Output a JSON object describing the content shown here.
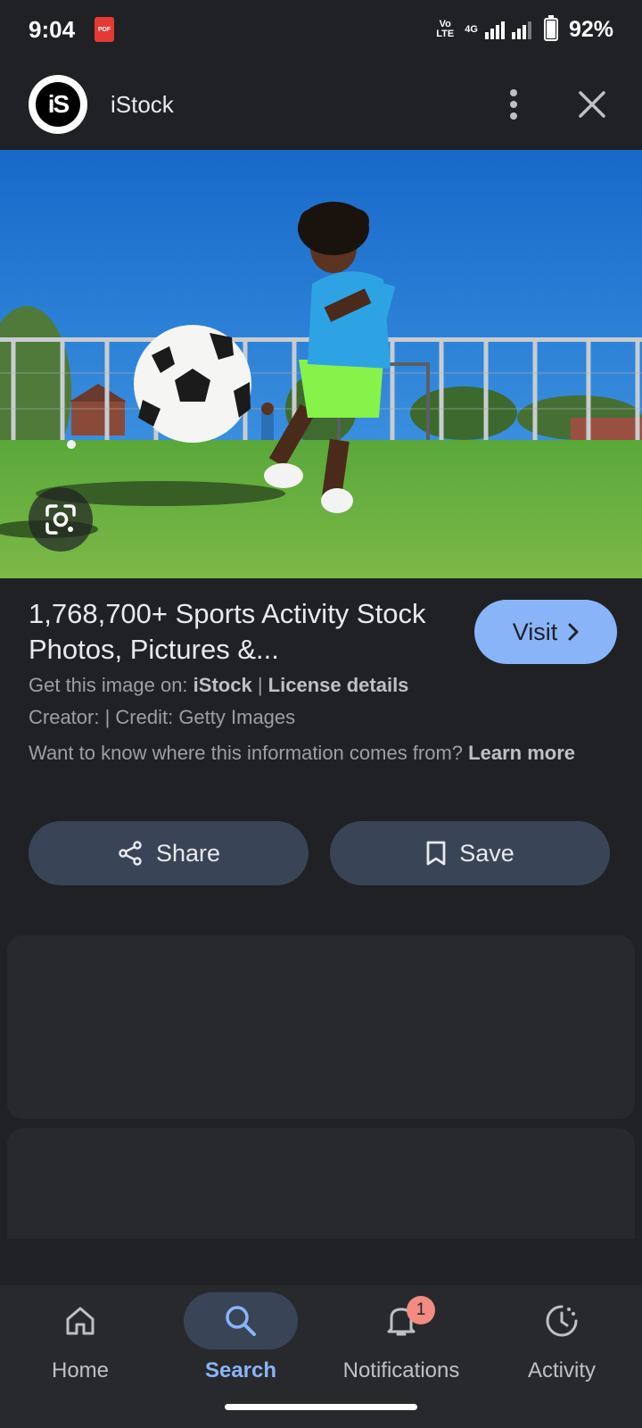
{
  "status": {
    "time": "9:04",
    "pdf_badge": "PDF",
    "network_top": "Vo LTE",
    "network_gen": "4G",
    "battery": "92%"
  },
  "header": {
    "logo_text": "iS",
    "site_name": "iStock"
  },
  "image": {
    "description_icon": "google-lens-icon"
  },
  "result": {
    "title": "1,768,700+ Sports Activity Stock Photos, Pictures &...",
    "visit_label": "Visit",
    "source_prefix": "Get this image on:",
    "source_name": "iStock",
    "separator": "|",
    "license_label": "License details",
    "creator_line": "Creator: | Credit: Getty Images",
    "info_question": "Want to know where this information comes from?",
    "learn_more": "Learn more"
  },
  "actions": {
    "share_label": "Share",
    "save_label": "Save"
  },
  "nav": {
    "items": [
      {
        "label": "Home",
        "icon": "home-icon"
      },
      {
        "label": "Search",
        "icon": "search-icon"
      },
      {
        "label": "Notifications",
        "icon": "bell-icon",
        "badge": "1"
      },
      {
        "label": "Activity",
        "icon": "activity-icon"
      }
    ]
  },
  "colors": {
    "accent": "#8ab4f8",
    "button_bg": "#394457",
    "background": "#202124",
    "badge": "#f28b82"
  }
}
